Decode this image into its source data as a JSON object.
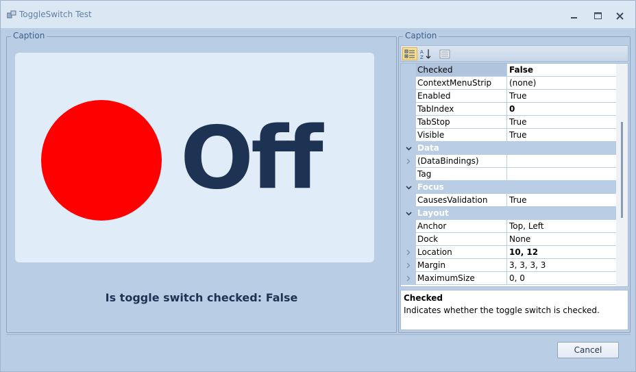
{
  "window": {
    "title": "ToggleSwitch Test"
  },
  "left_group": {
    "caption": "Caption"
  },
  "right_group": {
    "caption": "Caption"
  },
  "toggle": {
    "text": "Off",
    "checked": false,
    "knob_color": "#ff0000",
    "panel_color": "#e1ecf9",
    "text_color": "#1e3354"
  },
  "status": {
    "label": "Is toggle switch checked: False"
  },
  "property_grid": {
    "toolbar": {
      "categorized_icon": "categorized-icon",
      "alphabetical_icon": "alphabetical-icon",
      "property_pages_icon": "property-pages-icon"
    },
    "rows": [
      {
        "name": "Checked",
        "value": "False",
        "bold": true,
        "selected": true
      },
      {
        "name": "ContextMenuStrip",
        "value": "(none)"
      },
      {
        "name": "Enabled",
        "value": "True"
      },
      {
        "name": "TabIndex",
        "value": "0",
        "bold": true
      },
      {
        "name": "TabStop",
        "value": "True"
      },
      {
        "name": "Visible",
        "value": "True"
      }
    ],
    "categories": {
      "data": {
        "label": "Data",
        "rows": [
          {
            "name": "(DataBindings)",
            "value": "",
            "expandable": true
          },
          {
            "name": "Tag",
            "value": ""
          }
        ]
      },
      "focus": {
        "label": "Focus",
        "rows": [
          {
            "name": "CausesValidation",
            "value": "True"
          }
        ]
      },
      "layout": {
        "label": "Layout",
        "rows": [
          {
            "name": "Anchor",
            "value": "Top, Left"
          },
          {
            "name": "Dock",
            "value": "None"
          },
          {
            "name": "Location",
            "value": "10, 12",
            "bold": true,
            "expandable": true
          },
          {
            "name": "Margin",
            "value": "3, 3, 3, 3",
            "expandable": true
          },
          {
            "name": "MaximumSize",
            "value": "0, 0",
            "expandable": true
          }
        ]
      }
    },
    "help": {
      "title": "Checked",
      "description": "Indicates whether the toggle switch is checked."
    }
  },
  "buttons": {
    "cancel_label": "Cancel"
  }
}
